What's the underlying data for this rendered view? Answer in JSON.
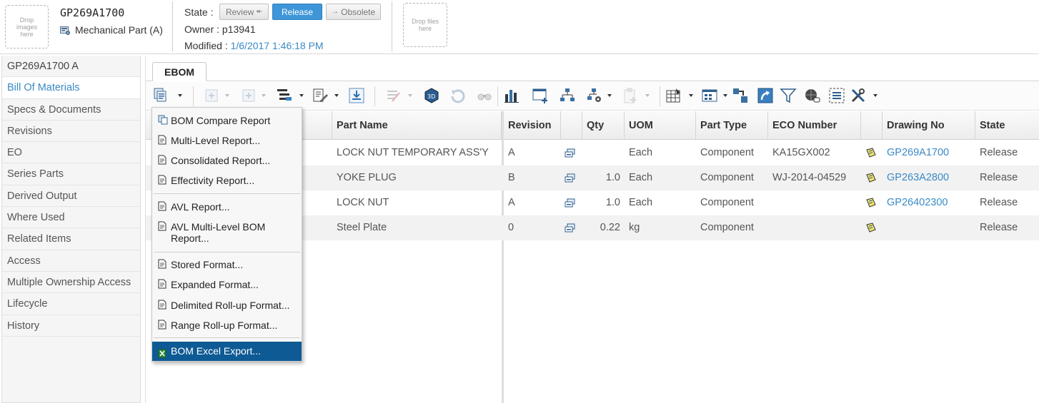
{
  "header": {
    "drop_images": "Drop images here",
    "drop_files": "Drop files here",
    "part_number": "GP269A1700",
    "part_type": "Mechanical Part (A)",
    "state_label": "State :",
    "state_buttons": [
      {
        "label": "Review",
        "arrow": "↞"
      },
      {
        "label": "Release"
      },
      {
        "label": "Obsolete",
        "arrow": "→"
      }
    ],
    "owner_label": "Owner :",
    "owner_value": "p13941",
    "modified_label": "Modified :",
    "modified_value": "1/6/2017 1:46:18 PM"
  },
  "sidebar": {
    "items": [
      {
        "label": "GP269A1700 A"
      },
      {
        "label": "Bill Of Materials"
      },
      {
        "label": "Specs & Documents"
      },
      {
        "label": "Revisions"
      },
      {
        "label": "EO"
      },
      {
        "label": "Series Parts"
      },
      {
        "label": "Derived Output"
      },
      {
        "label": "Where Used"
      },
      {
        "label": "Related Items"
      },
      {
        "label": "Access"
      },
      {
        "label": "Multiple Ownership Access"
      },
      {
        "label": "Lifecycle"
      },
      {
        "label": "History"
      }
    ]
  },
  "tabs": [
    {
      "label": "EBOM"
    }
  ],
  "table": {
    "columns": [
      "Part Name",
      "Revision",
      "Qty",
      "UOM",
      "Part Type",
      "ECO Number",
      "Drawing No",
      "State"
    ],
    "rows": [
      {
        "part_name": "LOCK NUT TEMPORARY ASS'Y",
        "revision": "A",
        "qty": "",
        "uom": "Each",
        "part_type": "Component",
        "eco": "KA15GX002",
        "drawing": "GP269A1700",
        "state": "Release"
      },
      {
        "part_name": "YOKE PLUG",
        "revision": "B",
        "qty": "1.0",
        "uom": "Each",
        "part_type": "Component",
        "eco": "WJ-2014-04529",
        "drawing": "GP263A2800",
        "state": "Release"
      },
      {
        "part_name": "LOCK NUT",
        "revision": "A",
        "qty": "1.0",
        "uom": "Each",
        "part_type": "Component",
        "eco": "",
        "drawing": "GP26402300",
        "state": "Release"
      },
      {
        "part_name": "Steel Plate",
        "revision": "0",
        "qty": "0.22",
        "uom": "kg",
        "part_type": "Component",
        "eco": "",
        "drawing": "",
        "state": "Release"
      }
    ]
  },
  "menu": {
    "groups": [
      [
        "BOM Compare Report",
        "Multi-Level Report...",
        "Consolidated Report...",
        "Effectivity Report..."
      ],
      [
        "AVL Report...",
        "AVL Multi-Level BOM Report..."
      ],
      [
        "Stored Format...",
        "Expanded Format...",
        "Delimited Roll-up Format...",
        "Range Roll-up Format..."
      ],
      [
        "BOM Excel Export..."
      ]
    ],
    "selected": "BOM Excel Export..."
  },
  "colors": {
    "link": "#3a8ac6",
    "release_button": "#3e96d9",
    "menu_selected": "#0e5a94"
  }
}
